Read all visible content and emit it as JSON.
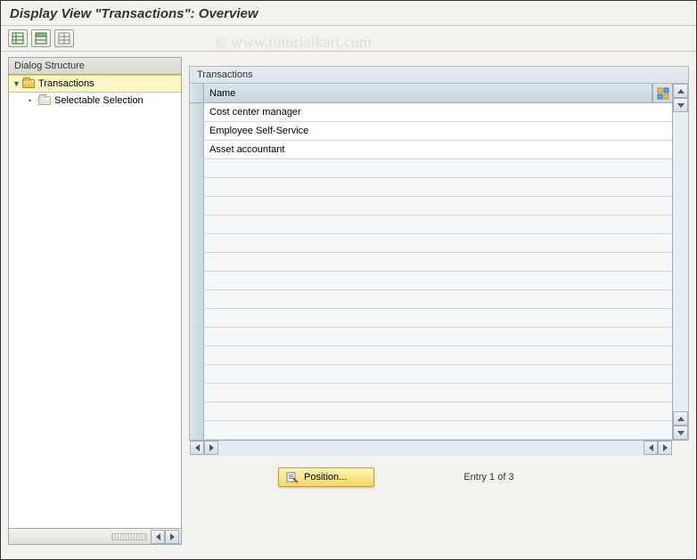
{
  "title": "Display View \"Transactions\": Overview",
  "watermark": "© www.tutorialkart.com",
  "toolbar": {
    "btn1": "expand-all",
    "btn2": "collapse-all",
    "btn3": "select-block"
  },
  "tree": {
    "header": "Dialog Structure",
    "nodes": [
      {
        "label": "Transactions",
        "selected": true,
        "expanded": true,
        "level": 0
      },
      {
        "label": "Selectable Selection",
        "selected": false,
        "expanded": false,
        "level": 1
      }
    ]
  },
  "group": {
    "title": "Transactions",
    "column_header": "Name",
    "rows": [
      "Cost center manager",
      "Employee Self-Service",
      "Asset accountant"
    ],
    "empty_row_count": 15
  },
  "position_button": "Position...",
  "entry_status": "Entry 1 of 3"
}
